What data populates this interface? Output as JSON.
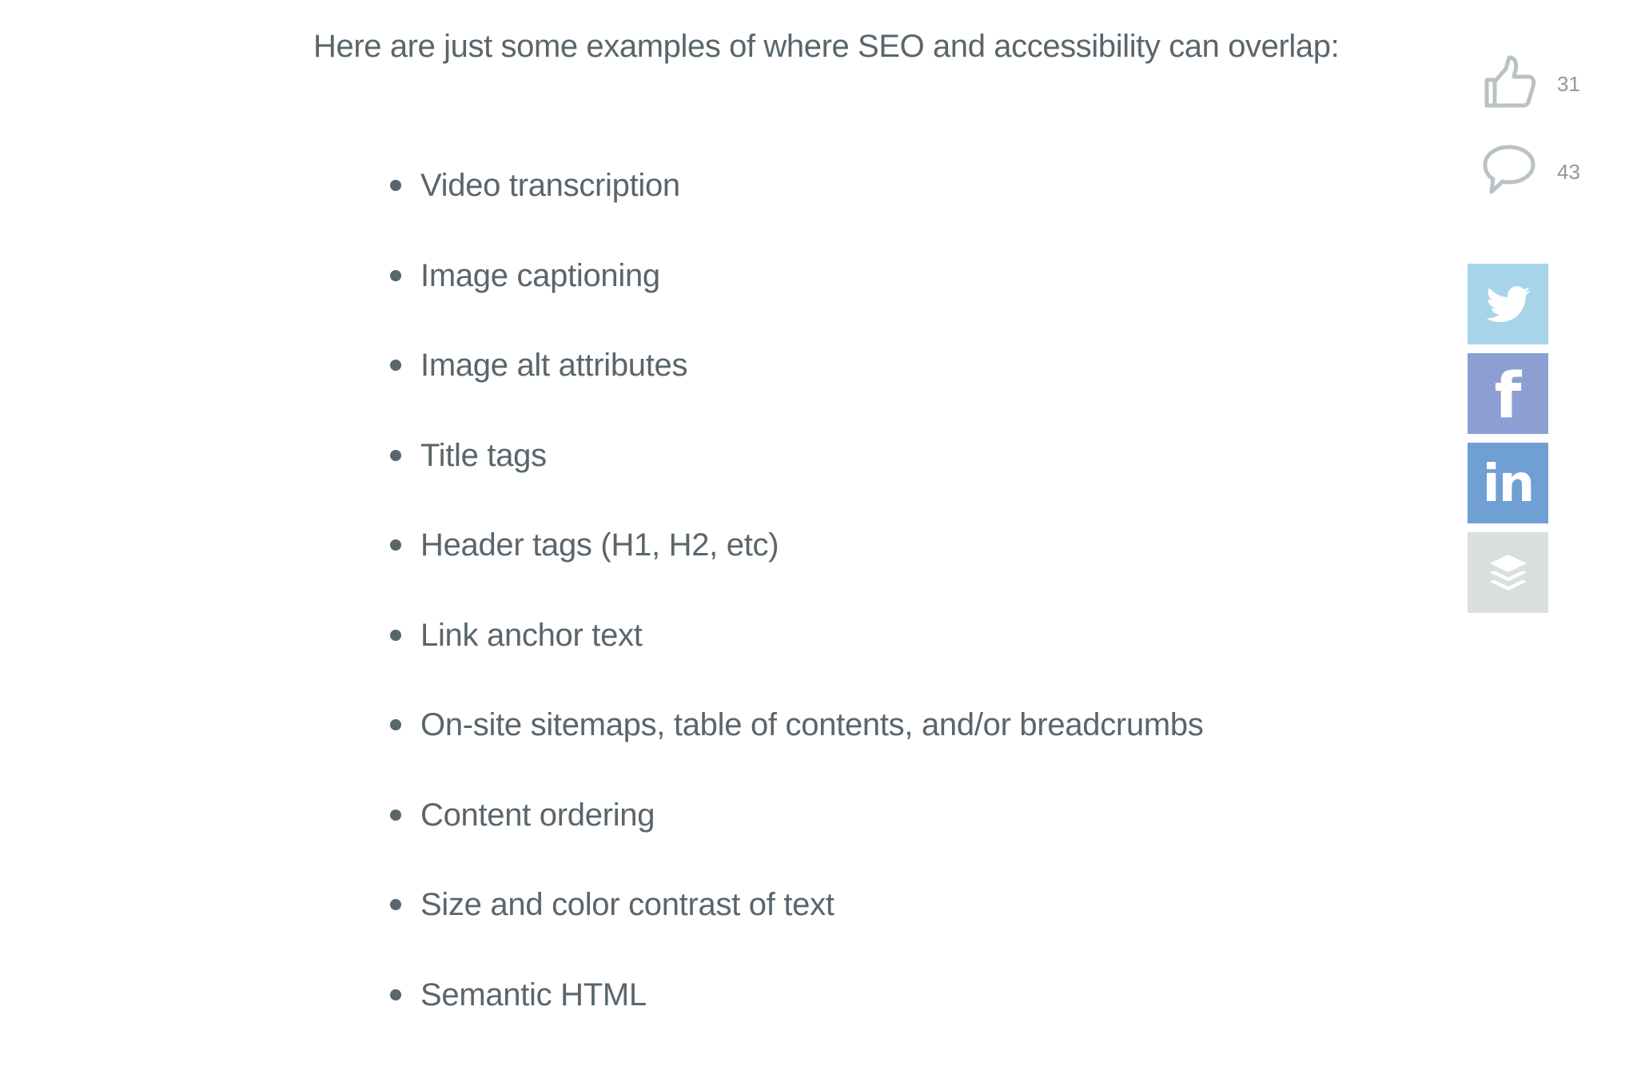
{
  "article": {
    "intro": "Here are just some examples of where SEO and accessibility can overlap:",
    "examples": [
      "Video transcription",
      "Image captioning",
      "Image alt attributes",
      "Title tags",
      "Header tags (H1, H2, etc)",
      "Link anchor text",
      "On-site sitemaps, table of contents, and/or breadcrumbs",
      "Content ordering",
      "Size and color contrast of text",
      "Semantic HTML"
    ]
  },
  "sidebar": {
    "likes": {
      "icon": "thumbs-up-icon",
      "count": "31"
    },
    "comments": {
      "icon": "comment-icon",
      "count": "43"
    },
    "share": [
      {
        "name": "twitter",
        "icon": "twitter-icon",
        "color": "#a8d4ea"
      },
      {
        "name": "facebook",
        "icon": "facebook-icon",
        "color": "#8d9fd2"
      },
      {
        "name": "linkedin",
        "icon": "linkedin-icon",
        "color": "#6f9fd3"
      },
      {
        "name": "buffer",
        "icon": "buffer-icon",
        "color": "#d9dedf"
      }
    ]
  },
  "colors": {
    "text": "#5a656c",
    "muted": "#8f999e",
    "icon_stroke": "#b9c2c4"
  }
}
